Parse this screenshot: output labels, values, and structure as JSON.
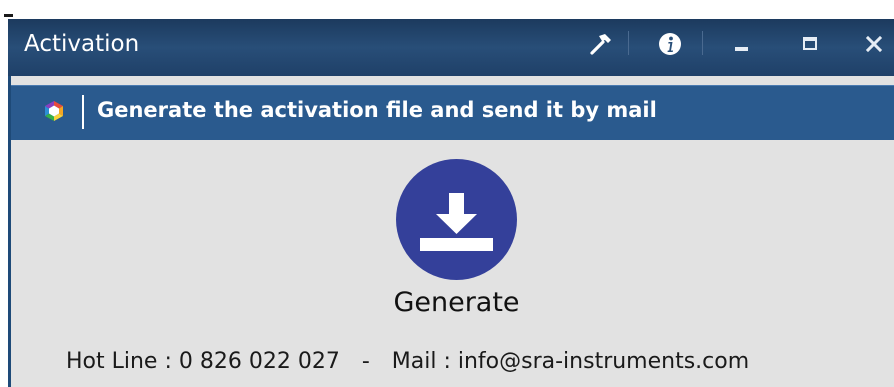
{
  "window": {
    "title": "Activation",
    "controls": {
      "tools": "hammer-icon",
      "info": "info-icon",
      "minimize": "minimize-icon",
      "maximize": "maximize-icon",
      "close": "close-icon"
    }
  },
  "banner": {
    "logo": "app-logo-icon",
    "title": "Generate the activation file and send it by mail"
  },
  "action": {
    "icon": "download-icon",
    "label": "Generate",
    "color": "#34409a"
  },
  "footer": {
    "hotline": "Hot Line : 0 826 022 027",
    "separator": "-",
    "mail": "Mail : info@sra-instruments.com"
  },
  "colors": {
    "titlebar": "#1f4068",
    "banner": "#2a5a8e",
    "body": "#e2e2e2"
  }
}
